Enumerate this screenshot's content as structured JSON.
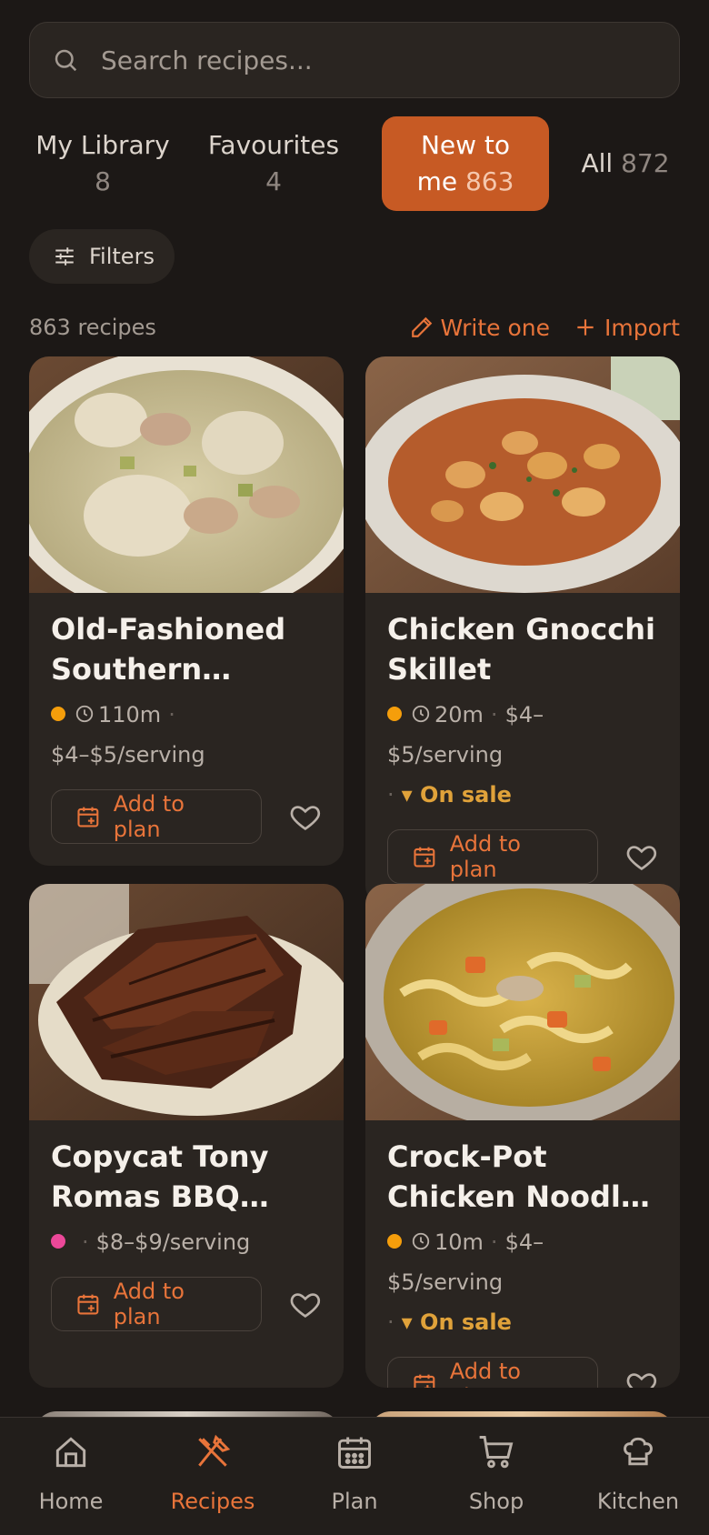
{
  "search": {
    "placeholder": "Search recipes..."
  },
  "tabs": [
    {
      "label": "My Library",
      "count": "8",
      "active": false
    },
    {
      "label": "Favourites",
      "count": "4",
      "active": false
    },
    {
      "label": "New to me",
      "count": "863",
      "active": true
    },
    {
      "label": "All",
      "count": "872",
      "active": false
    }
  ],
  "filters": {
    "label": "Filters"
  },
  "results": {
    "count_text": "863 recipes",
    "write_label": "Write one",
    "import_label": "Import"
  },
  "recipes": [
    {
      "title": "Old-Fashioned Southern Chicken and Dumplings",
      "dot_color": "#f59e0b",
      "time": "110m",
      "price": "$4–$5/serving",
      "on_sale": false,
      "add_label": "Add to plan"
    },
    {
      "title": "Chicken Gnocchi Skillet",
      "dot_color": "#f59e0b",
      "time": "20m",
      "price": "$4–$5/serving",
      "on_sale": true,
      "sale_label": "▾ On sale",
      "add_label": "Add to plan"
    },
    {
      "title": "Copycat Tony Romas BBQ Baby Back Ribs",
      "dot_color": "#ec4899",
      "time": "",
      "price": "$8–$9/serving",
      "on_sale": false,
      "add_label": "Add to plan"
    },
    {
      "title": "Crock-Pot Chicken Noodle Soup",
      "dot_color": "#f59e0b",
      "time": "10m",
      "price": "$4–$5/serving",
      "on_sale": true,
      "sale_label": "▾ On sale",
      "add_label": "Add to plan"
    }
  ],
  "nav": [
    {
      "label": "Home",
      "icon": "home-icon",
      "active": false
    },
    {
      "label": "Recipes",
      "icon": "utensils-icon",
      "active": true
    },
    {
      "label": "Plan",
      "icon": "calendar-icon",
      "active": false
    },
    {
      "label": "Shop",
      "icon": "cart-icon",
      "active": false
    },
    {
      "label": "Kitchen",
      "icon": "chef-hat-icon",
      "active": false
    }
  ],
  "colors": {
    "accent": "#e8743a",
    "active_tab": "#c75a24",
    "background": "#1c1816",
    "card": "#2a2521",
    "sale": "#e0a23a"
  }
}
